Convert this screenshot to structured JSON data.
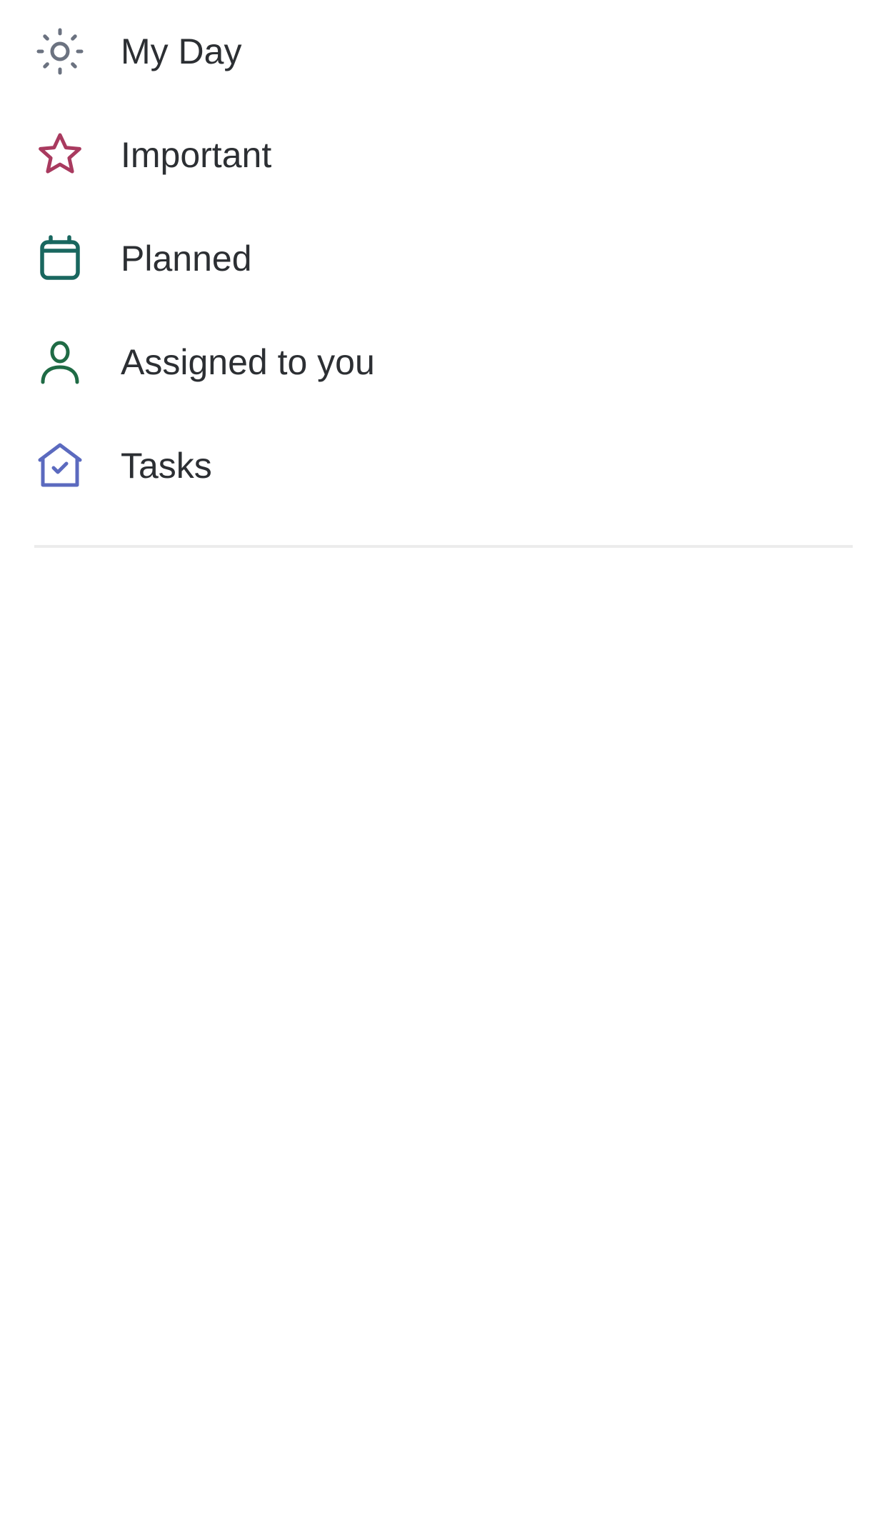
{
  "nav": {
    "items": [
      {
        "label": "My Day",
        "icon": "sun-icon",
        "color": "#6b7280"
      },
      {
        "label": "Important",
        "icon": "star-icon",
        "color": "#a93a5f"
      },
      {
        "label": "Planned",
        "icon": "calendar-icon",
        "color": "#19675f"
      },
      {
        "label": "Assigned to you",
        "icon": "person-icon",
        "color": "#1f6b45"
      },
      {
        "label": "Tasks",
        "icon": "home-icon",
        "color": "#5b6abf"
      }
    ]
  }
}
